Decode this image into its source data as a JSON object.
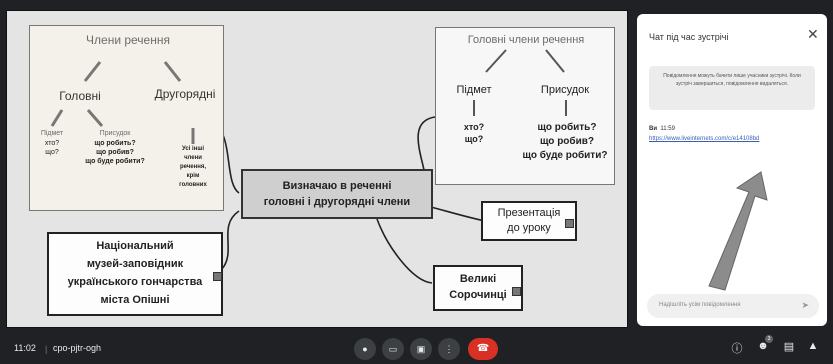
{
  "slide": {
    "mindmap_left": {
      "title": "Члени речення",
      "main": "Головні",
      "secondary": "Другорядні",
      "subject": "Підмет",
      "subject_q": [
        "хто?",
        "що?"
      ],
      "predicate": "Присудок",
      "predicate_q": [
        "що робить?",
        "що робив?",
        "що буде робити?"
      ],
      "secondary_desc": [
        "Усі інші",
        "члени",
        "речення,",
        "крім",
        "головних"
      ]
    },
    "mindmap_right": {
      "title": "Головні члени речення",
      "subject": "Підмет",
      "subject_q": [
        "хто?",
        "що?"
      ],
      "predicate": "Присудок",
      "predicate_q": [
        "що робить?",
        "що робив?",
        "що буде робити?"
      ]
    },
    "center": [
      "Визначаю в реченні",
      "головні і другорядні члени"
    ],
    "presentation": [
      "Презентація",
      "до уроку"
    ],
    "museum": [
      "Національний",
      "музей-заповідник",
      "українського гончарства",
      "міста Опішні"
    ],
    "village": [
      "Великі",
      "Сорочинці"
    ]
  },
  "chat": {
    "title": "Чат під час зустрічі",
    "close_icon": "close-icon",
    "notice": "Повідомлення можуть бачити лише учасники зустрічі. Коли зустріч завершиться, повідомлення видаляться.",
    "sender": "Ви",
    "time": "11:59",
    "link": "https://www.liveinternets.com/c/e14108bd",
    "input_placeholder": "Надішліть усім повідомлення",
    "send_icon": "send-icon"
  },
  "bottombar": {
    "time": "11:02",
    "meeting_code": "cpo-pjtr-ogh",
    "people_count": "3",
    "controls": [
      "mic-icon",
      "camera-icon",
      "present-icon",
      "more-icon",
      "hangup-icon"
    ],
    "right_icons": [
      "info-icon",
      "people-icon",
      "chat-icon",
      "activities-icon"
    ]
  }
}
